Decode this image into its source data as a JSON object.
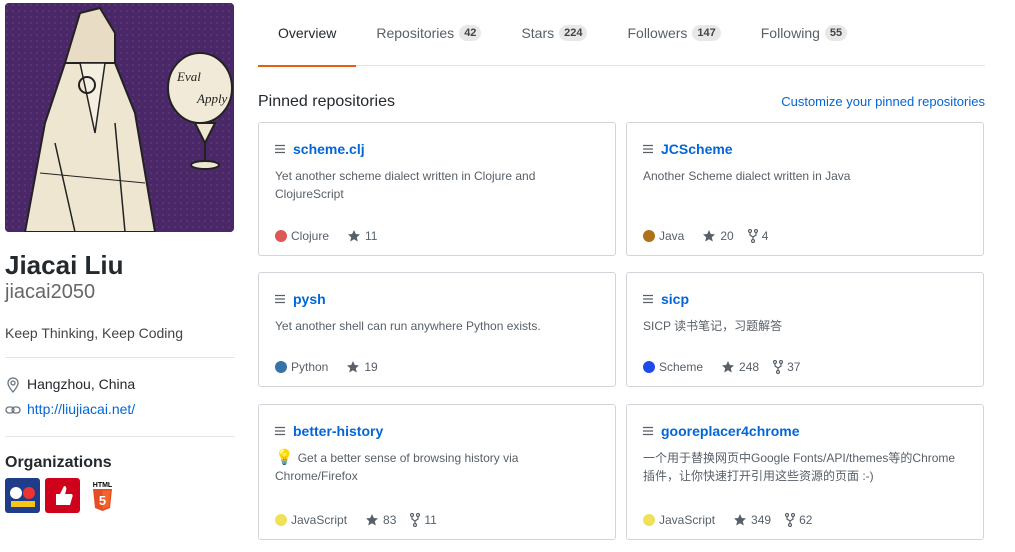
{
  "profile": {
    "fullname": "Jiacai Liu",
    "username": "jiacai2050",
    "bio": "Keep Thinking, Keep Coding",
    "location": "Hangzhou, China",
    "website": "http://liujiacai.net/",
    "avatar_text_1": "Eval",
    "avatar_text_2": "Apply"
  },
  "organizations": {
    "title": "Organizations",
    "items": [
      {
        "name": "org-1",
        "color": "#1f3c8a"
      },
      {
        "name": "org-2",
        "color": "#d0021b"
      },
      {
        "name": "org-3",
        "color": "#e44d26",
        "label": "HTML"
      }
    ]
  },
  "tabs": [
    {
      "label": "Overview",
      "count": null,
      "active": true
    },
    {
      "label": "Repositories",
      "count": "42"
    },
    {
      "label": "Stars",
      "count": "224"
    },
    {
      "label": "Followers",
      "count": "147"
    },
    {
      "label": "Following",
      "count": "55"
    }
  ],
  "pinned": {
    "title": "Pinned repositories",
    "customize": "Customize your pinned repositories",
    "repos": [
      {
        "name": "scheme.clj",
        "desc": "Yet another scheme dialect written in Clojure and ClojureScript",
        "lang": "Clojure",
        "color": "#db5855",
        "stars": "11",
        "forks": null
      },
      {
        "name": "JCScheme",
        "desc": "Another Scheme dialect written in Java",
        "lang": "Java",
        "color": "#b07219",
        "stars": "20",
        "forks": "4"
      },
      {
        "name": "pysh",
        "desc": "Yet another shell can run anywhere Python exists.",
        "lang": "Python",
        "color": "#3572A5",
        "stars": "19",
        "forks": null
      },
      {
        "name": "sicp",
        "desc": "SICP 读书笔记，习题解答",
        "lang": "Scheme",
        "color": "#1e4aec",
        "stars": "248",
        "forks": "37"
      },
      {
        "name": "better-history",
        "desc": "Get a better sense of browsing history via Chrome/Firefox",
        "lang": "JavaScript",
        "color": "#f1e05a",
        "stars": "83",
        "forks": "11",
        "bulb": "💡"
      },
      {
        "name": "gooreplacer4chrome",
        "desc": "一个用于替换网页中Google Fonts/API/themes等的Chrome插件，让你快速打开引用这些资源的页面 :-)",
        "lang": "JavaScript",
        "color": "#f1e05a",
        "stars": "349",
        "forks": "62"
      }
    ]
  }
}
